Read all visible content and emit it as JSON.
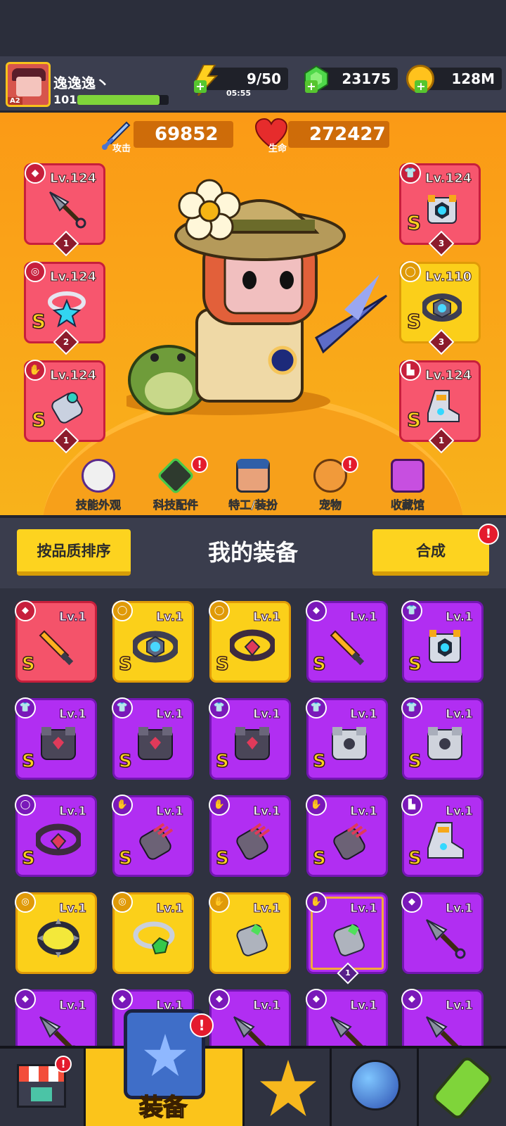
{
  "player": {
    "name": "逸逸逸丶",
    "level": "101",
    "rank": "A2",
    "xp_fraction": 0.9
  },
  "resources": {
    "energy": "9/50",
    "energy_timer": "05:55",
    "gems": "23175",
    "coins": "128M"
  },
  "stats": {
    "attack_label": "攻击",
    "attack_value": "69852",
    "hp_label": "生命",
    "hp_value": "272427"
  },
  "equipped": {
    "left": [
      {
        "level": "Lv.124",
        "grade": "",
        "stars": "1",
        "slot_icon": "weapon-icon",
        "item_icon": "kunai-icon",
        "rarity": "red"
      },
      {
        "level": "Lv.124",
        "grade": "S",
        "stars": "2",
        "slot_icon": "necklace-icon",
        "item_icon": "star-necklace-icon",
        "rarity": "red"
      },
      {
        "level": "Lv.124",
        "grade": "S",
        "stars": "1",
        "slot_icon": "glove-icon",
        "item_icon": "gauntlet-icon",
        "rarity": "red"
      }
    ],
    "right": [
      {
        "level": "Lv.124",
        "grade": "S",
        "stars": "3",
        "slot_icon": "armor-icon",
        "item_icon": "mech-armor-icon",
        "rarity": "red"
      },
      {
        "level": "Lv.110",
        "grade": "S",
        "stars": "3",
        "slot_icon": "belt-icon",
        "item_icon": "belt-hex-icon",
        "rarity": "gold"
      },
      {
        "level": "Lv.124",
        "grade": "S",
        "stars": "1",
        "slot_icon": "boot-icon",
        "item_icon": "mech-boot-icon",
        "rarity": "red"
      }
    ]
  },
  "menu": [
    {
      "label": "技能外观",
      "icon": "skill-skin-icon",
      "alert": false
    },
    {
      "label": "科技配件",
      "icon": "tech-parts-icon",
      "alert": true
    },
    {
      "label": "特工/装扮",
      "icon": "agent-costume-icon",
      "alert": false
    },
    {
      "label": "宠物",
      "icon": "pet-icon",
      "alert": true
    },
    {
      "label": "收藏馆",
      "icon": "collection-icon",
      "alert": false
    }
  ],
  "equipment_header": {
    "sort_label": "按品质排序",
    "title": "我的装备",
    "merge_label": "合成",
    "alert": "!"
  },
  "inventory": [
    {
      "level": "Lv.1",
      "grade": "S",
      "rarity": "red",
      "icon": "sword-icon",
      "slot": "weapon"
    },
    {
      "level": "Lv.1",
      "grade": "S",
      "rarity": "gold",
      "icon": "belt-hex-icon",
      "slot": "belt"
    },
    {
      "level": "Lv.1",
      "grade": "S",
      "rarity": "gold",
      "icon": "belt-gem-icon",
      "slot": "belt"
    },
    {
      "level": "Lv.1",
      "grade": "S",
      "rarity": "purple",
      "icon": "sword-icon",
      "slot": "weapon"
    },
    {
      "level": "Lv.1",
      "grade": "S",
      "rarity": "purple",
      "icon": "mech-armor-icon",
      "slot": "armor"
    },
    {
      "level": "Lv.1",
      "grade": "S",
      "rarity": "purple",
      "icon": "dark-armor-icon",
      "slot": "armor"
    },
    {
      "level": "Lv.1",
      "grade": "S",
      "rarity": "purple",
      "icon": "dark-armor-icon",
      "slot": "armor"
    },
    {
      "level": "Lv.1",
      "grade": "S",
      "rarity": "purple",
      "icon": "dark-armor-icon",
      "slot": "armor"
    },
    {
      "level": "Lv.1",
      "grade": "S",
      "rarity": "purple",
      "icon": "silver-armor-icon",
      "slot": "armor"
    },
    {
      "level": "Lv.1",
      "grade": "S",
      "rarity": "purple",
      "icon": "silver-armor-icon",
      "slot": "armor"
    },
    {
      "level": "Lv.1",
      "grade": "S",
      "rarity": "purple",
      "icon": "belt-gem-icon",
      "slot": "belt"
    },
    {
      "level": "Lv.1",
      "grade": "S",
      "rarity": "purple",
      "icon": "claw-gauntlet-icon",
      "slot": "glove"
    },
    {
      "level": "Lv.1",
      "grade": "S",
      "rarity": "purple",
      "icon": "claw-gauntlet-icon",
      "slot": "glove"
    },
    {
      "level": "Lv.1",
      "grade": "S",
      "rarity": "purple",
      "icon": "claw-gauntlet-icon",
      "slot": "glove"
    },
    {
      "level": "Lv.1",
      "grade": "S",
      "rarity": "purple",
      "icon": "mech-boot-icon",
      "slot": "boot"
    },
    {
      "level": "Lv.1",
      "grade": "",
      "rarity": "gold",
      "icon": "spiked-ring-icon",
      "slot": "necklace"
    },
    {
      "level": "Lv.1",
      "grade": "",
      "rarity": "gold",
      "icon": "emerald-ring-icon",
      "slot": "necklace"
    },
    {
      "level": "Lv.1",
      "grade": "",
      "rarity": "gold",
      "icon": "green-gauntlet-icon",
      "slot": "glove"
    },
    {
      "level": "Lv.1",
      "grade": "",
      "rarity": "purple",
      "icon": "green-gauntlet-icon",
      "slot": "glove",
      "selected": true,
      "stars": "1"
    },
    {
      "level": "Lv.1",
      "grade": "",
      "rarity": "purple",
      "icon": "kunai-icon",
      "slot": "weapon"
    },
    {
      "level": "Lv.1",
      "grade": "",
      "rarity": "purple",
      "icon": "kunai-icon",
      "slot": "weapon"
    },
    {
      "level": "Lv.1",
      "grade": "",
      "rarity": "purple",
      "icon": "kunai-icon",
      "slot": "weapon"
    },
    {
      "level": "Lv.1",
      "grade": "",
      "rarity": "purple",
      "icon": "kunai-icon",
      "slot": "weapon"
    },
    {
      "level": "Lv.1",
      "grade": "",
      "rarity": "purple",
      "icon": "kunai-icon",
      "slot": "weapon"
    },
    {
      "level": "Lv.1",
      "grade": "",
      "rarity": "purple",
      "icon": "kunai-icon",
      "slot": "weapon"
    }
  ],
  "bottom_nav": [
    {
      "name": "shop-tab",
      "icon": "shop-icon",
      "alert": true,
      "label": ""
    },
    {
      "name": "equipment-tab",
      "icon": "equipment-icon",
      "alert": true,
      "label": "装备",
      "active": true
    },
    {
      "name": "skills-tab",
      "icon": "star-swords-icon",
      "alert": false,
      "label": ""
    },
    {
      "name": "world-tab",
      "icon": "planet-icon",
      "alert": false,
      "label": ""
    },
    {
      "name": "evolve-tab",
      "icon": "dna-capsule-icon",
      "alert": false,
      "label": ""
    }
  ],
  "colors": {
    "stage_orange": "#fb9a16",
    "rarity_red": "#f4536a",
    "rarity_gold": "#fbd01a",
    "rarity_purple": "#b12ef2",
    "accent_yellow": "#fdd31f",
    "alert_red": "#e41b2d"
  }
}
